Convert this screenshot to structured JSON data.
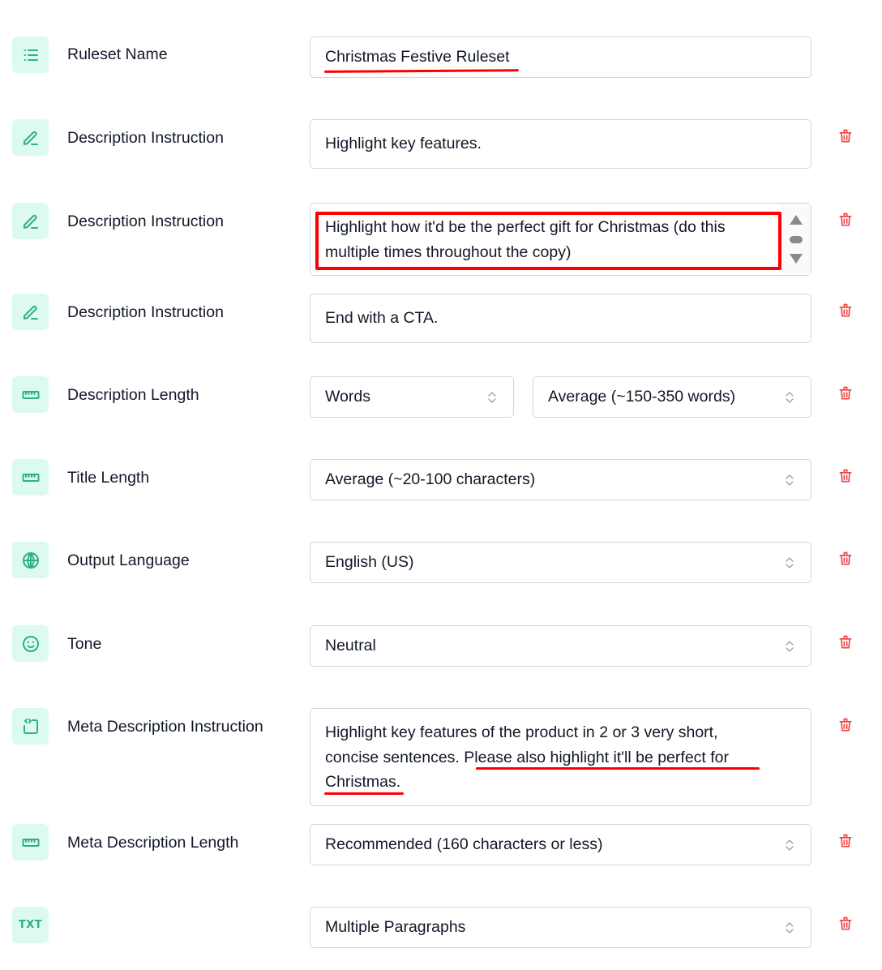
{
  "colors": {
    "accent": "#2fb083",
    "icon_bg": "#dcfaf1",
    "delete": "#ef4444",
    "annotation": "#ff0000",
    "border": "#d1d5db"
  },
  "rules": [
    {
      "icon": "list-icon",
      "label": "Ruleset Name",
      "type": "text",
      "value": "Christmas Festive Ruleset",
      "deletable": false
    },
    {
      "icon": "pencil-icon",
      "label": "Description Instruction",
      "type": "textarea",
      "value": "Highlight key features.",
      "deletable": true
    },
    {
      "icon": "pencil-icon",
      "label": "Description Instruction",
      "type": "textarea",
      "value_lines": [
        "Highlight how it'd be the perfect gift for Christmas (do this",
        "multiple times throughout the copy)"
      ],
      "value": "Highlight how it'd be the perfect gift for Christmas (do this multiple times throughout the copy)",
      "deletable": true
    },
    {
      "icon": "pencil-icon",
      "label": "Description Instruction",
      "type": "textarea",
      "value": "End with a CTA.",
      "deletable": true
    },
    {
      "icon": "ruler-icon",
      "label": "Description Length",
      "type": "select-pair",
      "unit": "Words",
      "value": "Average (~150-350 words)",
      "deletable": true
    },
    {
      "icon": "ruler-icon",
      "label": "Title Length",
      "type": "select",
      "value": "Average (~20-100 characters)",
      "deletable": true
    },
    {
      "icon": "globe-icon",
      "label": "Output Language",
      "type": "select",
      "value": "English (US)",
      "deletable": true
    },
    {
      "icon": "smiley-icon",
      "label": "Tone",
      "type": "select",
      "value": "Neutral",
      "deletable": true
    },
    {
      "icon": "code-frame-icon",
      "label": "Meta Description Instruction",
      "type": "textarea",
      "value_lines": [
        "Highlight key features of the product in 2 or 3 very short,",
        "concise sentences. ",
        "Please also highlight it'll be perfect for",
        "Christmas."
      ],
      "value": "Highlight key features of the product in 2 or 3 very short, concise sentences. Please also highlight it'll be perfect for Christmas.",
      "deletable": true
    },
    {
      "icon": "ruler-icon",
      "label": "Meta Description Length",
      "type": "select",
      "value": "Recommended (160 characters or less)",
      "deletable": true
    },
    {
      "icon": "txt-icon",
      "icon_text": "TXT",
      "label": "",
      "type": "select",
      "value": "Multiple Paragraphs",
      "deletable": true
    }
  ]
}
